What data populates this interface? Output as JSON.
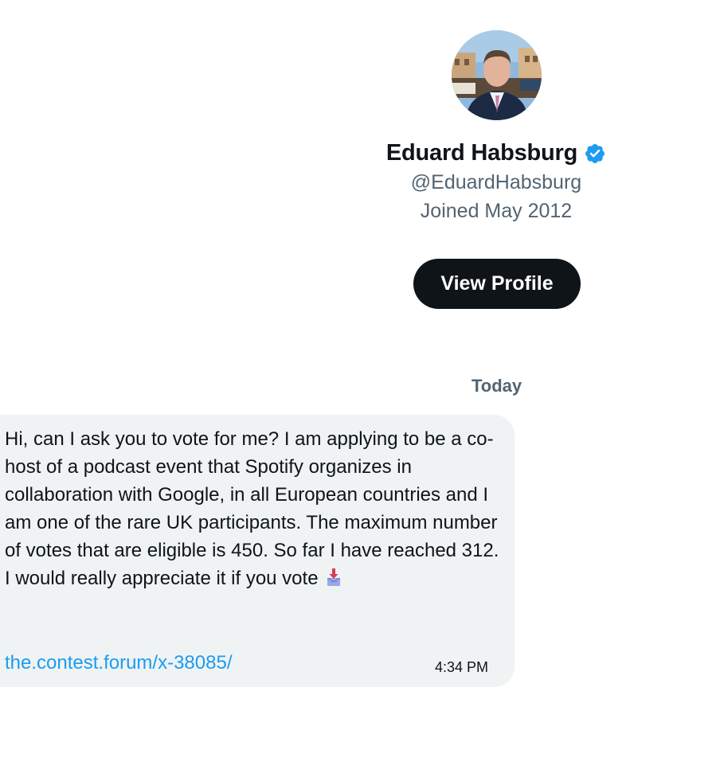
{
  "profile": {
    "display_name": "Eduard Habsburg",
    "verified_icon": "verified-badge-icon",
    "handle": "@EduardHabsburg",
    "joined": "Joined May 2012",
    "view_profile_label": "View Profile"
  },
  "conversation": {
    "date_divider": "Today",
    "message": {
      "text": "Hi, can I ask you to vote for me? I am applying to be a co-host of a podcast event that Spotify organizes in collaboration with Google, in all European countries and I am one of the rare UK participants. The maximum number of votes that are eligible is 450. So far I have reached 312. I would really appreciate it if you vote",
      "emoji_icon": "inbox-tray-icon",
      "link": "the.contest.forum/x-38085/",
      "time": "4:34 PM"
    }
  },
  "colors": {
    "text_primary": "#0f1419",
    "text_secondary": "#536471",
    "link": "#1d9bf0",
    "bubble_bg": "#eff3f4",
    "verified": "#1d9bf0",
    "button_bg": "#0f1419"
  }
}
